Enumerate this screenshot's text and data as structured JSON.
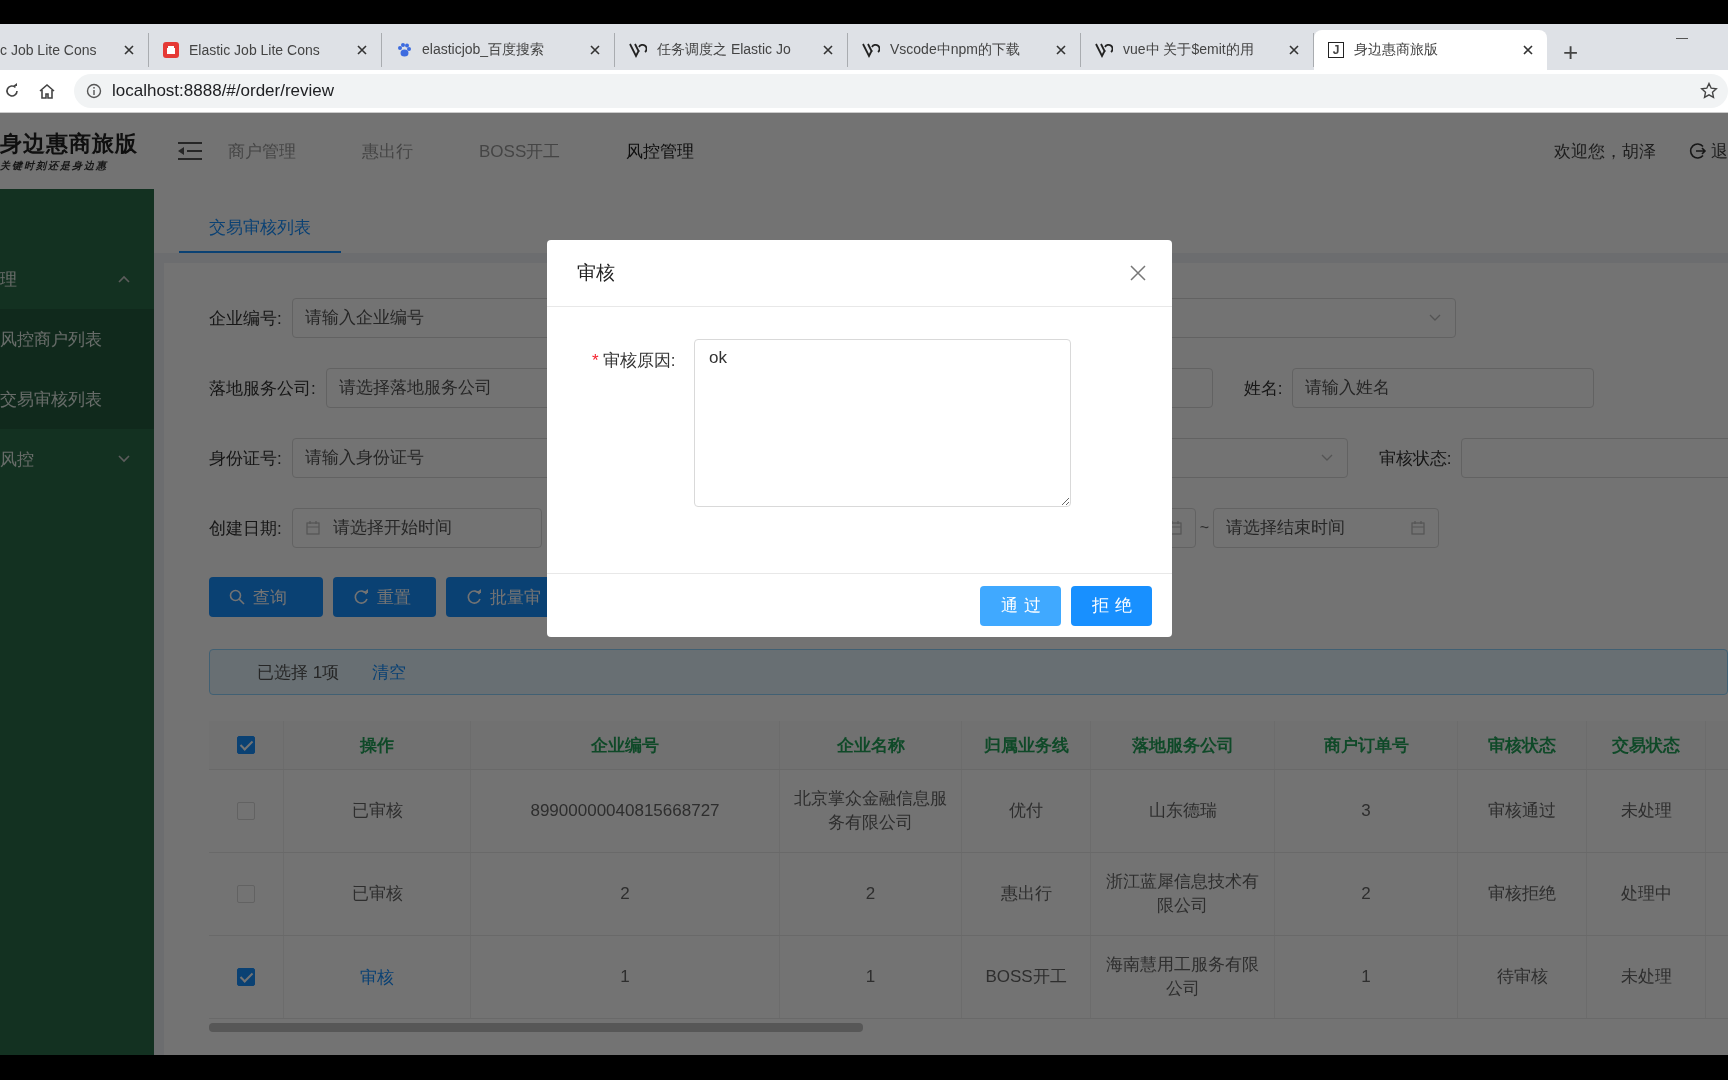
{
  "browser": {
    "tabs": [
      {
        "title": "c Job Lite Cons",
        "selected": false
      },
      {
        "title": "Elastic Job Lite Cons",
        "selected": false,
        "kind": "red"
      },
      {
        "title": "elasticjob_百度搜索",
        "selected": false,
        "kind": "paw"
      },
      {
        "title": "任务调度之 Elastic Jo",
        "selected": false,
        "kind": "v"
      },
      {
        "title": "Vscode中npm的下载",
        "selected": false,
        "kind": "v"
      },
      {
        "title": "vue中 关于$emit的用",
        "selected": false,
        "kind": "v"
      },
      {
        "title": "身边惠商旅版",
        "selected": true,
        "kind": "glyph",
        "icon_glyph": "J"
      }
    ],
    "new_tab": "+",
    "url": "localhost:8888/#/order/review"
  },
  "header": {
    "logo": "身边惠商旅版",
    "slogan": "关键时刻还是身边惠",
    "nav": [
      {
        "label": "商户管理",
        "selected": false
      },
      {
        "label": "惠出行",
        "selected": false
      },
      {
        "label": "BOSS开工",
        "selected": false
      },
      {
        "label": "风控管理",
        "selected": true
      }
    ],
    "welcome": "欢迎您，胡泽",
    "logout": "退"
  },
  "sidebar": {
    "groups": [
      {
        "label": "理",
        "expanded": true,
        "children": [
          {
            "label": "风控商户列表"
          },
          {
            "label": "交易审核列表"
          }
        ]
      },
      {
        "label": "风控",
        "expanded": false
      }
    ]
  },
  "page_tabs": [
    {
      "label": "交易审核列表",
      "selected": true
    }
  ],
  "form": {
    "rows": [
      [
        {
          "label": "企业编号:",
          "placeholder": "请输入企业编号",
          "kind": "input"
        },
        {
          "kind": "select"
        }
      ],
      [
        {
          "label": "落地服务公司:",
          "placeholder": "请选择落地服务公司",
          "kind": "input"
        },
        {
          "kind": "input"
        },
        {
          "label": "姓名:",
          "placeholder": "请输入姓名",
          "kind": "input"
        }
      ],
      [
        {
          "label": "身份证号:",
          "placeholder": "请输入身份证号",
          "kind": "input"
        },
        {
          "kind": "select"
        },
        {
          "label": "审核状态:",
          "kind": "input"
        }
      ],
      [
        {
          "label": "创建日期:",
          "placeholder": "请选择开始时间",
          "kind": "date"
        },
        {
          "kind": "date"
        },
        {
          "placeholder": "请选择结束时间",
          "kind": "date",
          "separator": "~"
        }
      ]
    ]
  },
  "actions": [
    {
      "label": "查询",
      "kind": "search"
    },
    {
      "label": "重置",
      "kind": "refresh"
    },
    {
      "label": "批量审",
      "kind": "refresh"
    }
  ],
  "selection": {
    "text": "已选择 1项",
    "clear": "清空"
  },
  "table": {
    "select_all": {
      "checked": true
    },
    "columns": [
      "操作",
      "企业编号",
      "企业名称",
      "归属业务线",
      "落地服务公司",
      "商户订单号",
      "审核状态",
      "交易状态"
    ],
    "rows": [
      {
        "checked": false,
        "kind": "text",
        "cells": [
          "已审核",
          "89900000040815668727",
          "北京掌众金融信息服务有限公司",
          "优付",
          "山东德瑞",
          "3",
          "审核通过",
          "未处理"
        ]
      },
      {
        "checked": false,
        "kind": "text",
        "cells": [
          "已审核",
          "2",
          "2",
          "惠出行",
          "浙江蓝犀信息技术有限公司",
          "2",
          "审核拒绝",
          "处理中"
        ]
      },
      {
        "checked": true,
        "kind": "link",
        "cells": [
          "审核",
          "1",
          "1",
          "BOSS开工",
          "海南慧用工服务有限公司",
          "1",
          "待审核",
          "未处理"
        ]
      }
    ]
  },
  "modal": {
    "title": "审核",
    "field": {
      "required_mark": "*",
      "label": "审核原因:",
      "value": "ok"
    },
    "buttons": [
      {
        "label": "通过",
        "hovered": true
      },
      {
        "label": "拒绝",
        "hovered": false
      }
    ]
  }
}
